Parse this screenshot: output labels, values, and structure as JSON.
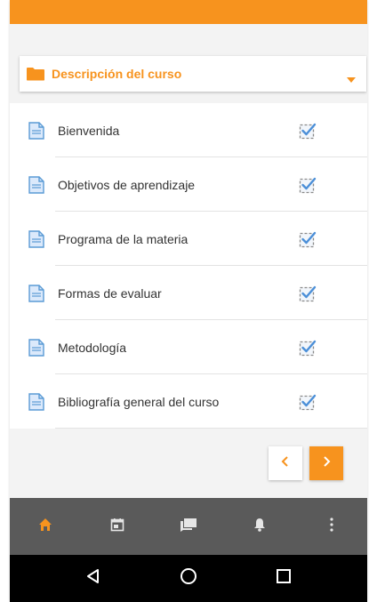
{
  "colors": {
    "accent": "#f7931e",
    "bottom_nav": "#5a5a5a",
    "nav_active": "#f7931e",
    "nav_inactive": "#e6e6e6"
  },
  "section_dropdown": {
    "label": "Descripción del curso",
    "icon": "folder-icon"
  },
  "items": [
    {
      "label": "Bienvenida",
      "icon": "page-icon",
      "status_icon": "checked-checkbox-icon"
    },
    {
      "label": "Objetivos de aprendizaje",
      "icon": "page-icon",
      "status_icon": "checked-checkbox-icon"
    },
    {
      "label": "Programa de la materia",
      "icon": "page-icon",
      "status_icon": "checked-checkbox-icon"
    },
    {
      "label": "Formas de evaluar",
      "icon": "page-icon",
      "status_icon": "checked-checkbox-icon"
    },
    {
      "label": "Metodología",
      "icon": "page-icon",
      "status_icon": "checked-checkbox-icon"
    },
    {
      "label": "Bibliografía general del curso",
      "icon": "page-icon",
      "status_icon": "checked-checkbox-icon"
    }
  ],
  "pager": {
    "prev_icon": "chevron-left-icon",
    "next_icon": "chevron-right-icon"
  },
  "bottom_nav": [
    {
      "icon": "home-icon",
      "active": true
    },
    {
      "icon": "calendar-icon",
      "active": false
    },
    {
      "icon": "messages-icon",
      "active": false
    },
    {
      "icon": "bell-icon",
      "active": false
    },
    {
      "icon": "more-vertical-icon",
      "active": false
    }
  ],
  "system_nav": [
    "back-icon",
    "home-circle-icon",
    "recents-icon"
  ]
}
